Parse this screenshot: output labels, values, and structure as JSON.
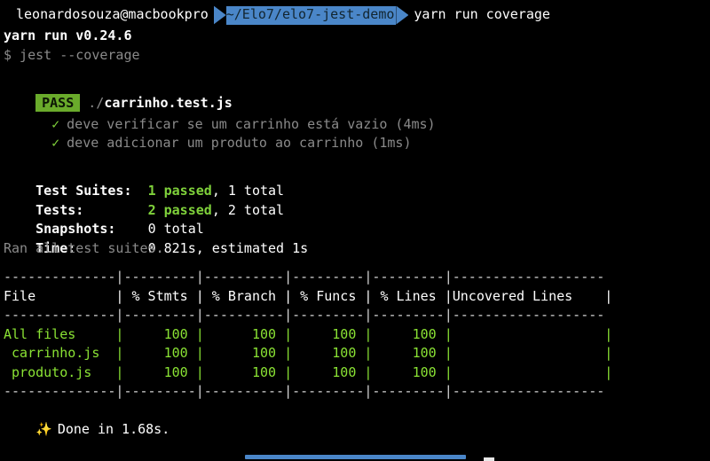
{
  "prompt": {
    "user_host": "leonardosouza@macbookpro",
    "path": "~/Elo7/elo7-jest-demo",
    "command": "yarn run coverage",
    "segment_bg": "#4a86c8",
    "segment_fg": "#12252f"
  },
  "output": {
    "yarn_version_line": "yarn run v0.24.6",
    "jest_command_line": "$ jest --coverage",
    "pass_badge": "PASS",
    "test_file_prefix": "./",
    "test_file_name": "carrinho.test.js",
    "tests": [
      {
        "check": "✓",
        "name": "deve verificar se um carrinho está vazio (4ms)"
      },
      {
        "check": "✓",
        "name": "deve adicionar um produto ao carrinho (1ms)"
      }
    ],
    "summary": [
      {
        "label": "Test Suites:",
        "pad": "  ",
        "highlight": "1 passed",
        "rest": ", 1 total"
      },
      {
        "label": "Tests:",
        "pad": "        ",
        "highlight": "2 passed",
        "rest": ", 2 total"
      },
      {
        "label": "Snapshots:",
        "pad": "    ",
        "highlight": "",
        "rest": "0 total"
      },
      {
        "label": "Time:",
        "pad": "         ",
        "highlight": "",
        "rest": "0.821s, estimated 1s"
      }
    ],
    "ran_all": "Ran all test suites.",
    "done_icon": "✨",
    "done_line": "Done in 1.68s."
  },
  "coverage_table": {
    "rule_top": "--------------|---------|----------|---------|---------|-------------------",
    "rule_mid": "--------------|---------|----------|---------|---------|-------------------",
    "rule_bottom": "--------------|---------|----------|---------|---------|-------------------",
    "header_row": "File          | % Stmts | % Branch | % Funcs | % Lines |Uncovered Lines    |",
    "columns": [
      "File",
      "% Stmts",
      "% Branch",
      "% Funcs",
      "% Lines",
      "Uncovered Lines"
    ],
    "rows": [
      {
        "text": "All files     |     100 |      100 |     100 |     100 |                   |",
        "file": "All files",
        "stmts": "100",
        "branch": "100",
        "funcs": "100",
        "lines": "100",
        "uncovered": ""
      },
      {
        "text": " carrinho.js  |     100 |      100 |     100 |     100 |                   |",
        "file": "carrinho.js",
        "stmts": "100",
        "branch": "100",
        "funcs": "100",
        "lines": "100",
        "uncovered": ""
      },
      {
        "text": " produto.js   |     100 |      100 |     100 |     100 |                   |",
        "file": "produto.js",
        "stmts": "100",
        "branch": "100",
        "funcs": "100",
        "lines": "100",
        "uncovered": ""
      }
    ]
  },
  "scrollbar": {
    "orientation": "horizontal",
    "thumb_color": "#4a86c8"
  }
}
